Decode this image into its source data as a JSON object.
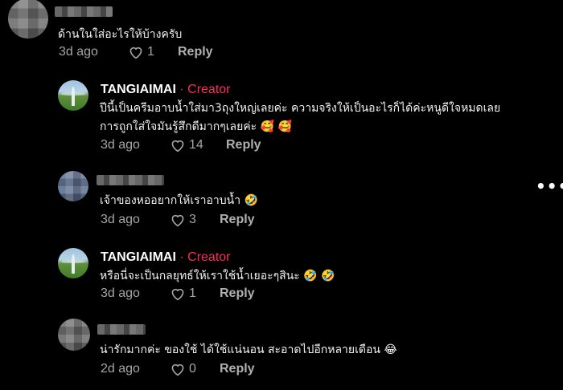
{
  "comments": [
    {
      "username": "",
      "text": "ด้านในใส่อะไรให้บ้างครับ",
      "date": "3d ago",
      "likes": "1",
      "reply_label": "Reply"
    },
    {
      "username": "TANGIAIMAI",
      "creator_tag": "· Creator",
      "text_line1": "ปีนี้เป็นครีมอาบน้ำใส่มา3ถุงใหญ่เลยค่ะ ความจริงให้เป็นอะไรก็ได้ค่ะหนูดีใจหมดเลย",
      "text_line2": "การถูกใส่ใจมันรู้สึกดีมากๆเลยค่ะ",
      "emoji": "🥰 🥰",
      "date": "3d ago",
      "likes": "14",
      "reply_label": "Reply"
    },
    {
      "username": "",
      "text": "เจ้าของหออยากให้เราอาบน้ำ",
      "emoji": "🤣",
      "date": "3d ago",
      "likes": "3",
      "reply_label": "Reply"
    },
    {
      "username": "TANGIAIMAI",
      "creator_tag": "· Creator",
      "text": "หรือนี่จะเป็นกลยุทธ์ให้เราใช้น้ำเยอะๆสินะ",
      "emoji": "🤣 🤣",
      "date": "3d ago",
      "likes": "1",
      "reply_label": "Reply"
    },
    {
      "username": "",
      "text": "น่ารักมากค่ะ ของใช้ ได้ใช้แน่นอน สะอาดไปอีกหลายเดือน",
      "emoji": "😂",
      "date": "2d ago",
      "likes": "0",
      "reply_label": "Reply"
    }
  ],
  "more_options": "•••",
  "icons": {
    "like": "heart-outline-icon",
    "more": "more-options-icon"
  },
  "colors": {
    "background": "#000000",
    "creator_tag": "#fe2c55",
    "meta_text": "#a5a5a5"
  }
}
